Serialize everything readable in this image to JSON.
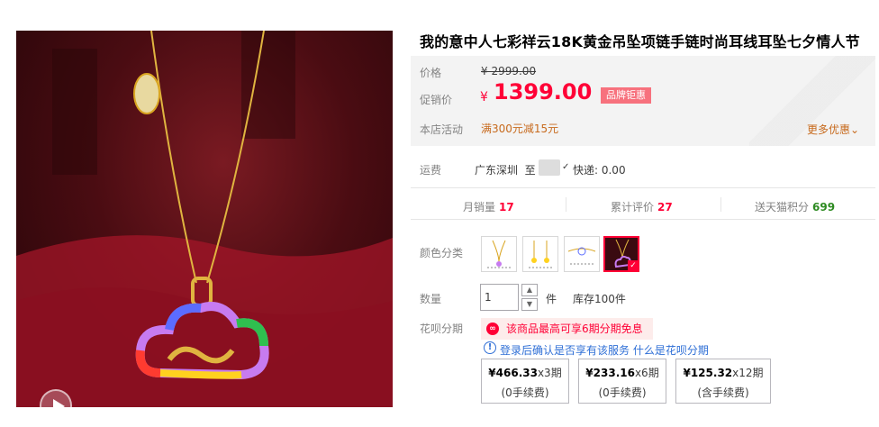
{
  "product": {
    "title": "我的意中人七彩祥云18K黄金吊坠项链手链时尚耳线耳坠七夕情人节"
  },
  "media": {
    "play_icon": "play-icon",
    "zoom_icon": "magnifier-icon",
    "zoom_glyph": "🔍"
  },
  "pricing": {
    "price_label": "价格",
    "original_price": "¥ 2999.00",
    "promo_label": "促销价",
    "currency": "¥",
    "promo_price": "1399.00",
    "badge": "品牌钜惠",
    "store_label": "本店活动",
    "store_promo": "满300元减15元",
    "more_deals": "更多优惠",
    "chevron": "⌄"
  },
  "shipping": {
    "label": "运费",
    "from": "广东深圳",
    "to": "至",
    "check": "✓",
    "fee": "快递: 0.00"
  },
  "stats": {
    "monthly_sales_label": "月销量",
    "monthly_sales": "17",
    "reviews_label": "累计评价",
    "reviews": "27",
    "points_label": "送天猫积分",
    "points": "699"
  },
  "sku": {
    "label": "颜色分类",
    "selected_index": 3,
    "selected_mark": "✓"
  },
  "quantity": {
    "label": "数量",
    "value": "1",
    "up": "▲",
    "down": "▼",
    "unit": "件",
    "stock": "库存100件"
  },
  "huabei": {
    "label": "花呗分期",
    "icon_glyph": "∞",
    "banner": "该商品最高可享6期分期免息",
    "info_glyph": "!",
    "login_tip": "登录后确认是否享有该服务",
    "what_is": "什么是花呗分期",
    "plans": [
      {
        "amount": "¥466.33",
        "periods": "x3期",
        "fee": "(0手续费)"
      },
      {
        "amount": "¥233.16",
        "periods": "x6期",
        "fee": "(0手续费)"
      },
      {
        "amount": "¥125.32",
        "periods": "x12期",
        "fee": "(含手续费)"
      }
    ]
  },
  "colors": {
    "accent": "#ff0036",
    "promo_orange": "#c76a1d",
    "link_blue": "#2f6fd6",
    "points_green": "#2e8b22",
    "gold": "#d9a521"
  }
}
